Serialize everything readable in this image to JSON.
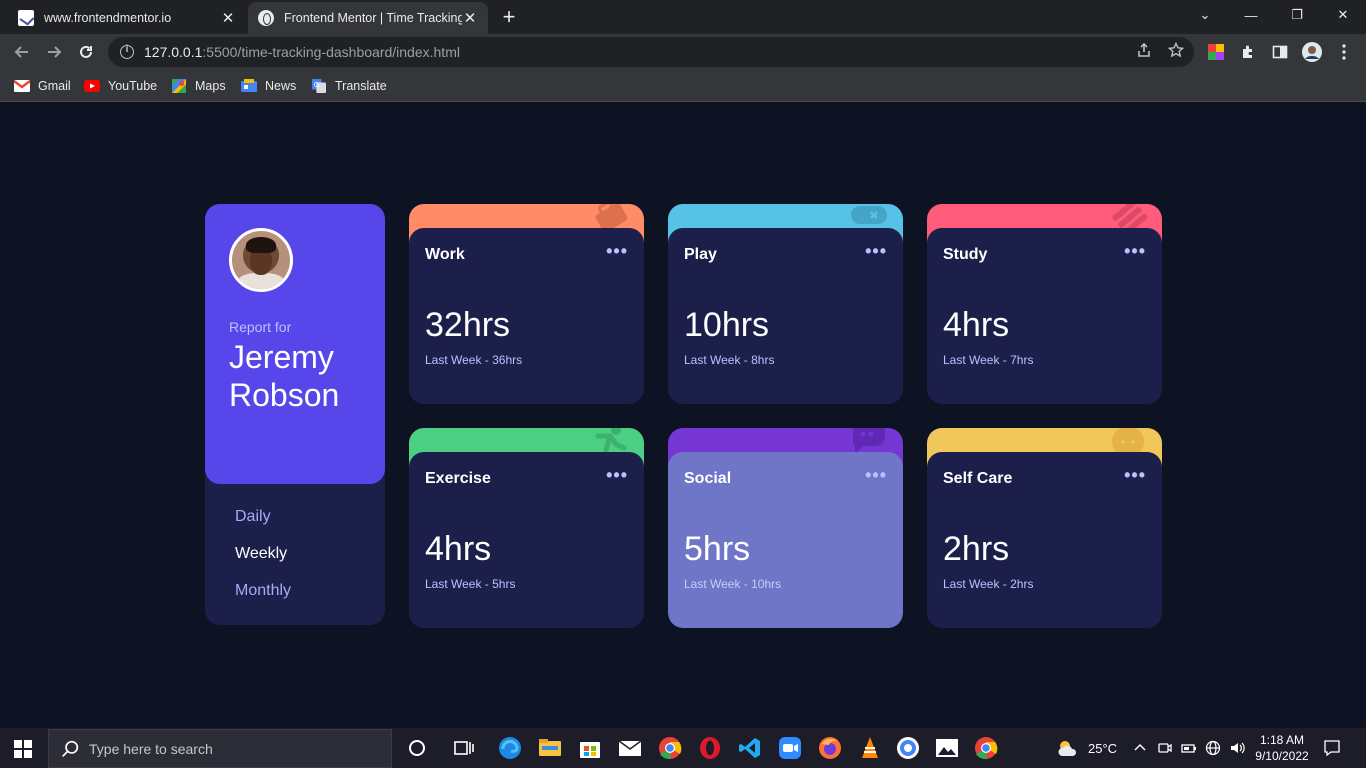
{
  "browser": {
    "tabs": [
      {
        "title": "www.frontendmentor.io",
        "close": "✕"
      },
      {
        "title": "Frontend Mentor | Time Tracking",
        "close": "✕"
      }
    ],
    "new_tab": "+",
    "window_controls": {
      "collapse": "⌄",
      "minimize": "—",
      "maximize": "❐",
      "close": "✕"
    },
    "url_host": "127.0.0.1",
    "url_path": ":5500/time-tracking-dashboard/index.html",
    "bookmarks": [
      {
        "label": "Gmail",
        "color": "#ea4335"
      },
      {
        "label": "YouTube",
        "color": "#ff0000"
      },
      {
        "label": "Maps",
        "color": "#34a853"
      },
      {
        "label": "News",
        "color": "#4285f4"
      },
      {
        "label": "Translate",
        "color": "#4285f4"
      }
    ]
  },
  "profile": {
    "report_for": "Report for",
    "name": "Jeremy Robson",
    "periods": [
      "Daily",
      "Weekly",
      "Monthly"
    ],
    "active_period": "Weekly"
  },
  "cards": [
    {
      "title": "Work",
      "hours": "32hrs",
      "previous": "Last Week - 36hrs",
      "color": "#ff8c66",
      "icon": "briefcase-icon"
    },
    {
      "title": "Play",
      "hours": "10hrs",
      "previous": "Last Week - 8hrs",
      "color": "#56c2e6",
      "icon": "gamepad-icon"
    },
    {
      "title": "Study",
      "hours": "4hrs",
      "previous": "Last Week - 7hrs",
      "color": "#ff5c7c",
      "icon": "book-icon"
    },
    {
      "title": "Exercise",
      "hours": "4hrs",
      "previous": "Last Week - 5hrs",
      "color": "#4bcf83",
      "icon": "runner-icon"
    },
    {
      "title": "Social",
      "hours": "5hrs",
      "previous": "Last Week - 10hrs",
      "color": "#7536d3",
      "icon": "chat-icon",
      "hovered": true
    },
    {
      "title": "Self Care",
      "hours": "2hrs",
      "previous": "Last Week - 2hrs",
      "color": "#f1c65b",
      "icon": "heart-icon"
    }
  ],
  "more_dots": "•••",
  "taskbar": {
    "search_placeholder": "Type here to search",
    "weather": "25°C",
    "time": "1:18 AM",
    "date": "9/10/2022"
  }
}
